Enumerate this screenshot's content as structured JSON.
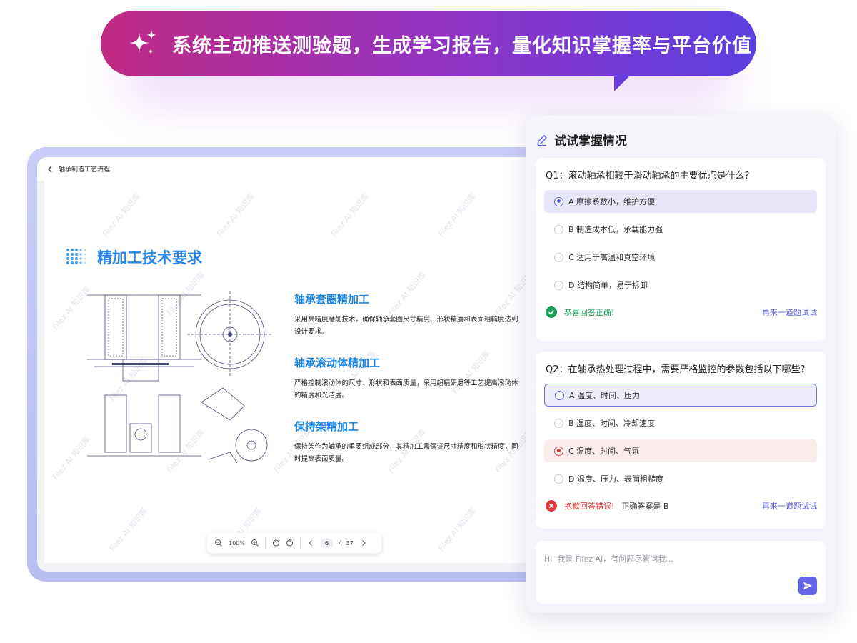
{
  "banner": {
    "text": "系统主动推送测验题，生成学习报告，量化知识掌握率与平台价值",
    "icon": "sparkle-icon"
  },
  "viewer": {
    "breadcrumb": "轴承制造工艺流程",
    "watermark": "Filez AI 知识库",
    "section_title": "精加工技术要求",
    "items": [
      {
        "title": "轴承套圈精加工",
        "desc": "采用高精度磨削技术，确保轴承套圈尺寸精度、形状精度和表面粗糙度达到设计要求。"
      },
      {
        "title": "轴承滚动体精加工",
        "desc": "严格控制滚动体的尺寸、形状和表面质量，采用超精研磨等工艺提高滚动体的精度和光洁度。"
      },
      {
        "title": "保持架精加工",
        "desc": "保持架作为轴承的重要组成部分，其精加工需保证尺寸精度和形状精度，同时提高表面质量。"
      }
    ],
    "pager": {
      "zoom": "100%",
      "page": "6",
      "sep": "/",
      "total": "37"
    }
  },
  "quiz": {
    "title": "试试掌握情况",
    "q1": {
      "question": "Q1：滚动轴承相较于滑动轴承的主要优点是什么?",
      "options": [
        "A 摩擦系数小，维护方便",
        "B 制造成本低，承载能力强",
        "C 适用于高温和真空环境",
        "D 结构简单，易于拆卸"
      ],
      "result": "恭喜回答正确!",
      "retry": "再来一道题试试"
    },
    "q2": {
      "question": "Q2：在轴承热处理过程中，需要严格监控的参数包括以下哪些?",
      "options": [
        "A 温度、时间、压力",
        "B 湿度、时间、冷却速度",
        "C 温度、时间、气氛",
        "D 温度、压力、表面粗糙度"
      ],
      "result": "抱歉回答错误!",
      "answer": "正确答案是 B",
      "retry": "再来一道题试试"
    },
    "chat_placeholder": "Hi  我是 Filez AI，有问题尽管问我..."
  },
  "colors": {
    "accent": "#5a5ee0",
    "title_blue": "#2b86e6",
    "success": "#1a9f58",
    "error": "#e03c3c"
  }
}
